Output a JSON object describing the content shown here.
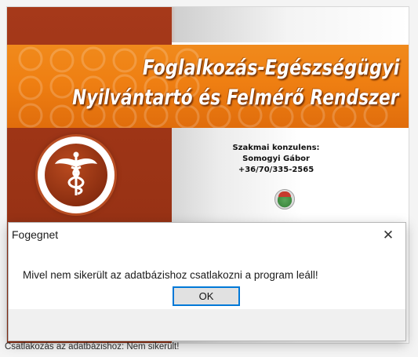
{
  "splash": {
    "title_line1": "Foglalkozás-Egészségügyi",
    "title_line2": "Nyilvántartó és Felmérő Rendszer",
    "consultant_label": "Szakmai konzulens:",
    "consultant_name": "Somogyi Gábor",
    "consultant_phone": "+36/70/335-2565",
    "logo_icon": "caduceus-icon",
    "seal_icon": "seal-icon"
  },
  "dialog": {
    "title": "Fogegnet",
    "close_label": "✕",
    "message": "Mivel nem sikerült az adatbázishoz csatlakozni a program leáll!",
    "ok_label": "OK"
  },
  "status": {
    "text": "Csatlakozás az adatbázishoz:  Nem sikerült!"
  },
  "colors": {
    "banner_orange": "#ef7f12",
    "brand_dark_red": "#9a3315",
    "focus_blue": "#0078d7"
  }
}
